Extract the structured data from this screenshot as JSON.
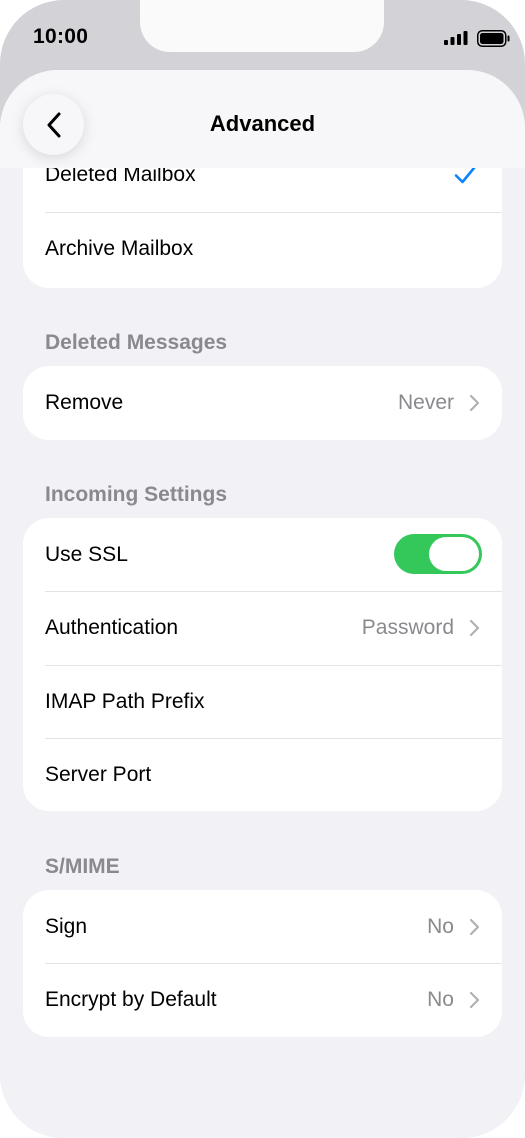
{
  "status_bar": {
    "time": "10:00"
  },
  "nav": {
    "title": "Advanced"
  },
  "mailbox_group": {
    "deleted_mailbox": "Deleted Mailbox",
    "archive_mailbox": "Archive Mailbox"
  },
  "deleted_messages": {
    "header": "Deleted Messages",
    "remove_label": "Remove",
    "remove_value": "Never"
  },
  "incoming_settings": {
    "header": "Incoming Settings",
    "use_ssl_label": "Use SSL",
    "use_ssl_on": true,
    "authentication_label": "Authentication",
    "authentication_value": "Password",
    "imap_path_prefix_label": "IMAP Path Prefix",
    "server_port_label": "Server Port"
  },
  "smime": {
    "header": "S/MIME",
    "sign_label": "Sign",
    "sign_value": "No",
    "encrypt_label": "Encrypt by Default",
    "encrypt_value": "No"
  },
  "colors": {
    "accent": "#0a84ff",
    "toggle_on": "#34c759",
    "secondary_text": "#8a8a8e",
    "background": "#f2f2f6"
  },
  "icons": {
    "back": "chevron-left-icon",
    "check": "checkmark-icon",
    "disclosure": "chevron-right-icon",
    "signal": "cellular-signal-icon",
    "battery": "battery-icon"
  }
}
